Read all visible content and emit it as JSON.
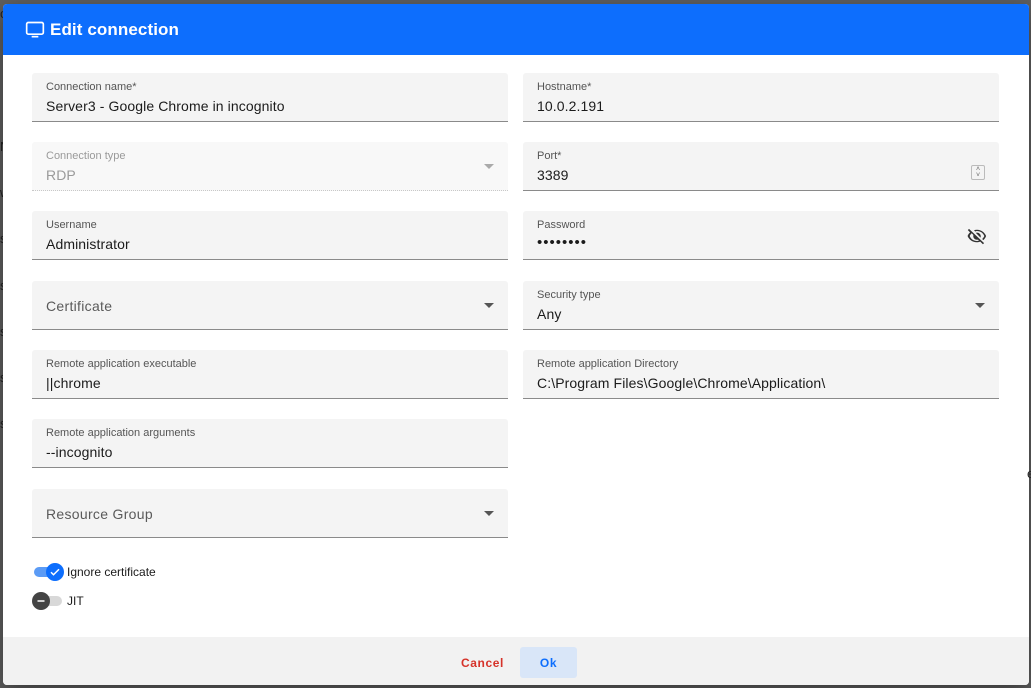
{
  "dialog": {
    "title": "Edit connection",
    "icon": "monitor-icon"
  },
  "fields": {
    "connection_name": {
      "label": "Connection name*",
      "value": "Server3 - Google Chrome in incognito"
    },
    "hostname": {
      "label": "Hostname*",
      "value": "10.0.2.191"
    },
    "connection_type": {
      "label": "Connection type",
      "value": "RDP"
    },
    "port": {
      "label": "Port*",
      "value": "3389"
    },
    "username": {
      "label": "Username",
      "value": "Administrator"
    },
    "password": {
      "label": "Password",
      "value": "••••••••"
    },
    "certificate": {
      "placeholder": "Certificate"
    },
    "security_type": {
      "label": "Security type",
      "value": "Any"
    },
    "remote_app_executable": {
      "label": "Remote application executable",
      "value": "||chrome"
    },
    "remote_app_directory": {
      "label": "Remote application Directory",
      "value": "C:\\Program Files\\Google\\Chrome\\Application\\"
    },
    "remote_app_arguments": {
      "label": "Remote application arguments",
      "value": "--incognito"
    },
    "resource_group": {
      "placeholder": "Resource Group"
    }
  },
  "toggles": {
    "ignore_certificate": {
      "label": "Ignore certificate",
      "checked": true
    },
    "jit": {
      "label": "JIT",
      "checked": false
    }
  },
  "footer": {
    "cancel_label": "Cancel",
    "ok_label": "Ok"
  },
  "colors": {
    "primary": "#0d6efd",
    "cancel": "#d6332a"
  }
}
